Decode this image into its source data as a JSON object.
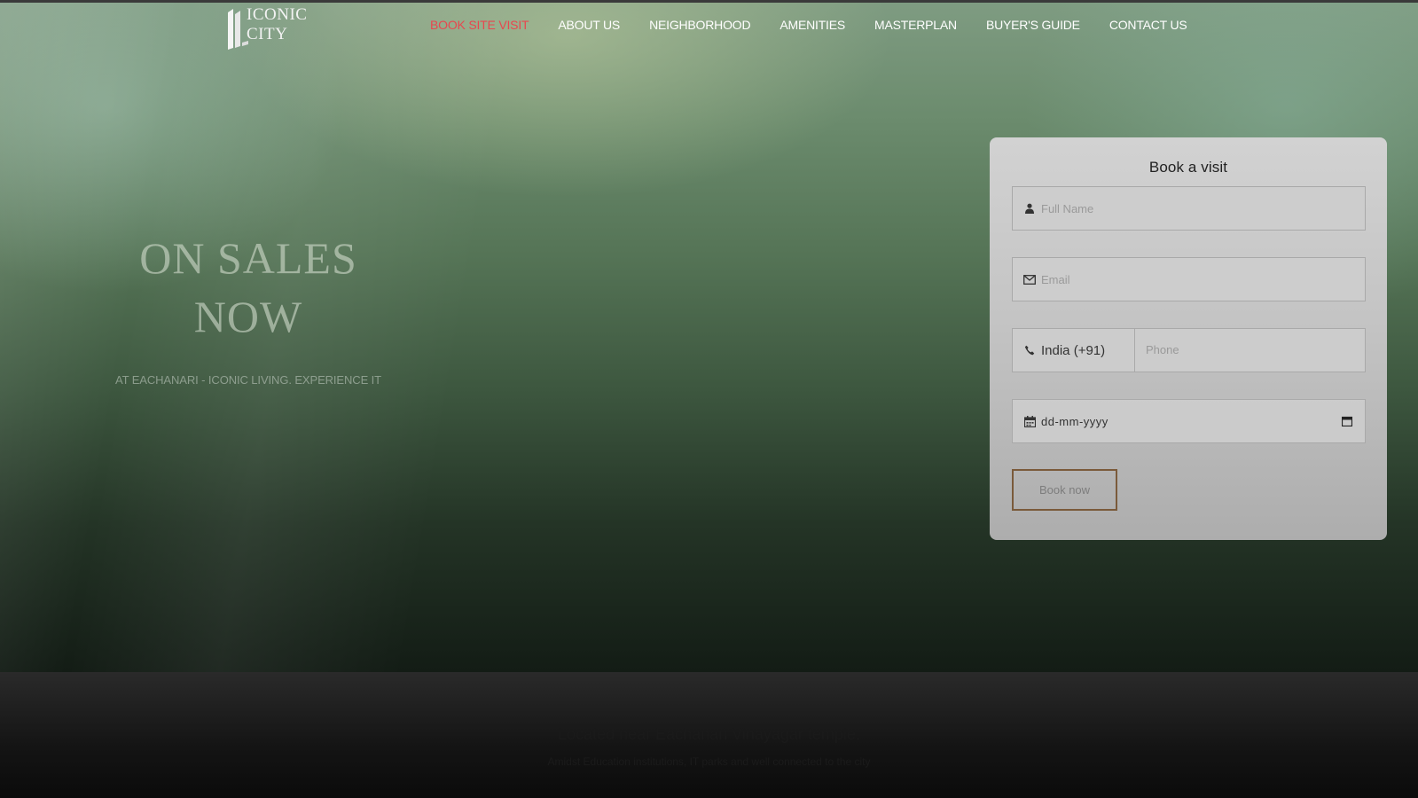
{
  "header": {
    "logo_text": "ICONIC CITY",
    "nav": [
      {
        "label": "BOOK SITE VISIT",
        "active": true
      },
      {
        "label": "ABOUT US"
      },
      {
        "label": "NEIGHBORHOOD"
      },
      {
        "label": "AMENITIES"
      },
      {
        "label": "MASTERPLAN"
      },
      {
        "label": "BUYER'S GUIDE"
      },
      {
        "label": "CONTACT US"
      }
    ]
  },
  "hero": {
    "title_line1": "ON SALES",
    "title_line2": "NOW",
    "subtitle": "AT EACHANARI - ICONIC LIVING. EXPERIENCE IT"
  },
  "form": {
    "title": "Book a visit",
    "full_name_placeholder": "Full Name",
    "email_placeholder": "Email",
    "country_value": "India (+91)",
    "phone_placeholder": "Phone",
    "date_placeholder": "dd-mm-yyyy",
    "submit_label": "Book now"
  },
  "footer": {
    "title": "Located near Eachanari Vinayagar temple.",
    "subtitle": "Amidst Education institutions, IT parks and well connected to the city"
  },
  "colors": {
    "nav_active": "#e8474f",
    "button_border": "#7a5a3a"
  }
}
